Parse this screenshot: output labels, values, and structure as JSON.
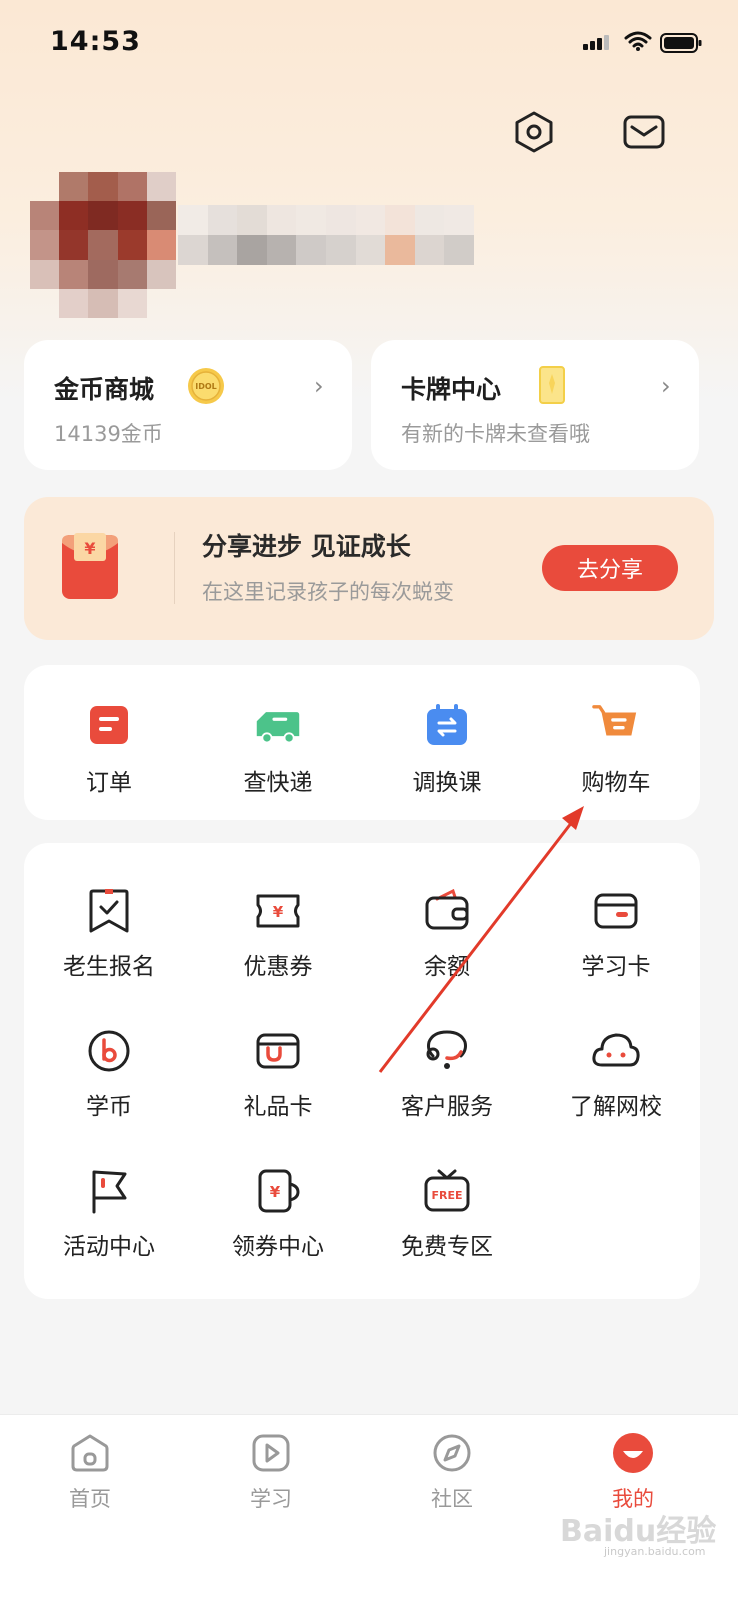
{
  "status_bar": {
    "time": "14:53"
  },
  "colors": {
    "accent": "#e94b3c",
    "hero_bg": "#fbe8d4",
    "page_bg": "#f5f5f5"
  },
  "header_icons": [
    "settings-icon",
    "mail-icon"
  ],
  "cards": {
    "coin_mall": {
      "title": "金币商城",
      "subtitle": "14139金币",
      "badge": "IDOL"
    },
    "card_center": {
      "title": "卡牌中心",
      "subtitle": "有新的卡牌未查看哦"
    }
  },
  "share_banner": {
    "title": "分享进步 见证成长",
    "subtitle": "在这里记录孩子的每次蜕变",
    "button": "去分享",
    "icon_glyph": "¥"
  },
  "quick_actions": [
    {
      "label": "订单",
      "icon": "order-icon",
      "color": "#e94b3c"
    },
    {
      "label": "查快递",
      "icon": "delivery-truck-icon",
      "color": "#4cc38a"
    },
    {
      "label": "调换课",
      "icon": "calendar-swap-icon",
      "color": "#4a8cf0"
    },
    {
      "label": "购物车",
      "icon": "shopping-cart-icon",
      "color": "#f08a3c"
    }
  ],
  "services": [
    {
      "label": "老生报名",
      "icon": "enroll-bookmark-icon"
    },
    {
      "label": "优惠券",
      "icon": "coupon-icon"
    },
    {
      "label": "余额",
      "icon": "wallet-icon"
    },
    {
      "label": "学习卡",
      "icon": "study-card-icon"
    },
    {
      "label": "学币",
      "icon": "study-coin-icon"
    },
    {
      "label": "礼品卡",
      "icon": "gift-card-icon"
    },
    {
      "label": "客户服务",
      "icon": "customer-service-icon"
    },
    {
      "label": "了解网校",
      "icon": "about-school-icon"
    },
    {
      "label": "活动中心",
      "icon": "flag-icon"
    },
    {
      "label": "领券中心",
      "icon": "coupon-center-icon"
    },
    {
      "label": "免费专区",
      "icon": "free-tv-icon"
    }
  ],
  "free_badge": "FREE",
  "tabbar": [
    {
      "label": "首页",
      "icon": "home-icon",
      "active": false
    },
    {
      "label": "学习",
      "icon": "play-icon",
      "active": false
    },
    {
      "label": "社区",
      "icon": "compass-icon",
      "active": false
    },
    {
      "label": "我的",
      "icon": "profile-icon",
      "active": true
    }
  ],
  "watermark": {
    "brand": "Baidu经验",
    "url": "jingyan.baidu.com"
  }
}
